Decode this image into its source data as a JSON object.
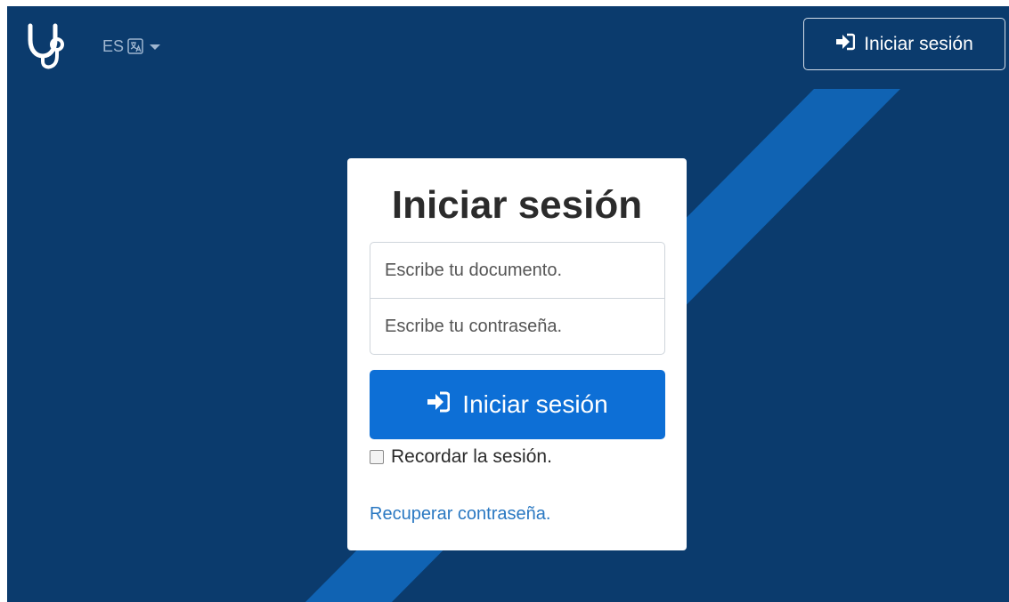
{
  "navbar": {
    "logo_icon": "stethoscope-icon",
    "language": {
      "code": "ES",
      "flag_icon": "translate-icon",
      "caret_icon": "caret-down-icon"
    },
    "login_button": {
      "icon": "sign-in-icon",
      "label": "Iniciar sesión"
    }
  },
  "login_form": {
    "title": "Iniciar sesión",
    "document_placeholder": "Escribe tu documento.",
    "document_value": "",
    "password_placeholder": "Escribe tu contraseña.",
    "password_value": "",
    "submit_icon": "sign-in-icon",
    "submit_label": "Iniciar sesión",
    "remember_label": "Recordar la sesión.",
    "remember_checked": false,
    "recover_link": "Recuperar contraseña."
  },
  "colors": {
    "background": "#0b3b6d",
    "stripe": "#1063b3",
    "primary_button": "#0d6fd6",
    "link": "#2a78c2",
    "card": "#ffffff"
  }
}
